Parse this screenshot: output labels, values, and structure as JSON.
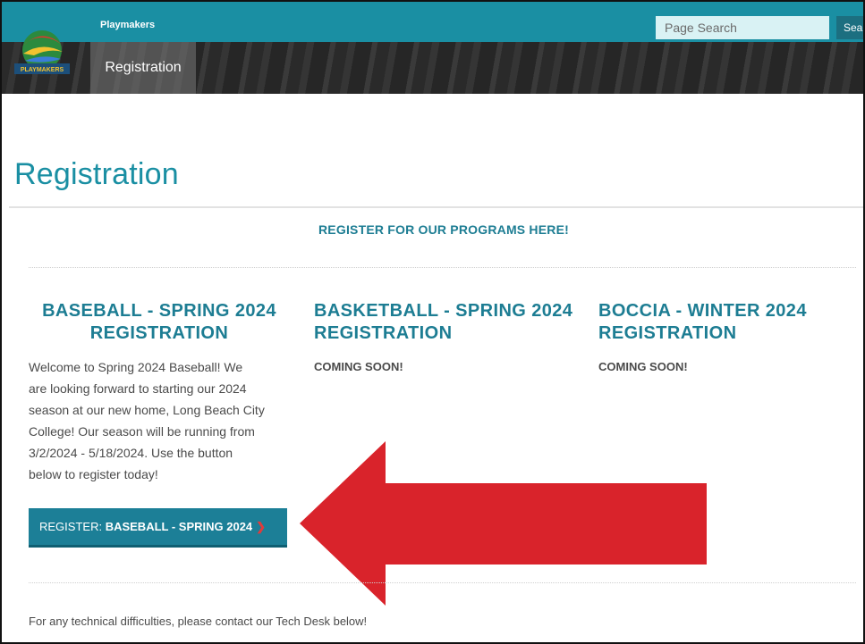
{
  "header": {
    "brand": "Playmakers",
    "logo_text": "PLAYMAKERS",
    "nav_active": "Registration",
    "search": {
      "placeholder": "Page Search",
      "button_label": "Search"
    }
  },
  "page": {
    "title": "Registration",
    "register_heading": "REGISTER FOR OUR PROGRAMS HERE!"
  },
  "columns": [
    {
      "title_line1": "BASEBALL - SPRING 2024",
      "title_line2": "REGISTRATION",
      "lines": [
        "Welcome to Spring 2024 Baseball! We",
        "are looking forward to starting our 2024",
        "season at our new home, Long Beach City",
        "College! Our season will be running from",
        "3/2/2024 - 5/18/2024. Use the button",
        "below to register today!"
      ],
      "button": {
        "prefix": "REGISTER: ",
        "strong": "BASEBALL - SPRING 2024",
        "chevron": "❯"
      }
    },
    {
      "title_line1": "BASKETBALL - SPRING 2024",
      "title_line2": "REGISTRATION",
      "status": "COMING SOON!"
    },
    {
      "title_line1": "BOCCIA - WINTER 2024",
      "title_line2": "REGISTRATION",
      "status": "COMING SOON!"
    }
  ],
  "footer_text": "For any technical difficulties, please contact our Tech Desk below!",
  "colors": {
    "teal": "#1a8fa3",
    "heading_teal": "#1d7d93",
    "button": "#1c7f97",
    "arrow_red": "#d9232b"
  },
  "icons": {
    "arrow": "left-arrow-annotation",
    "chevron": "chevron-right-icon"
  }
}
